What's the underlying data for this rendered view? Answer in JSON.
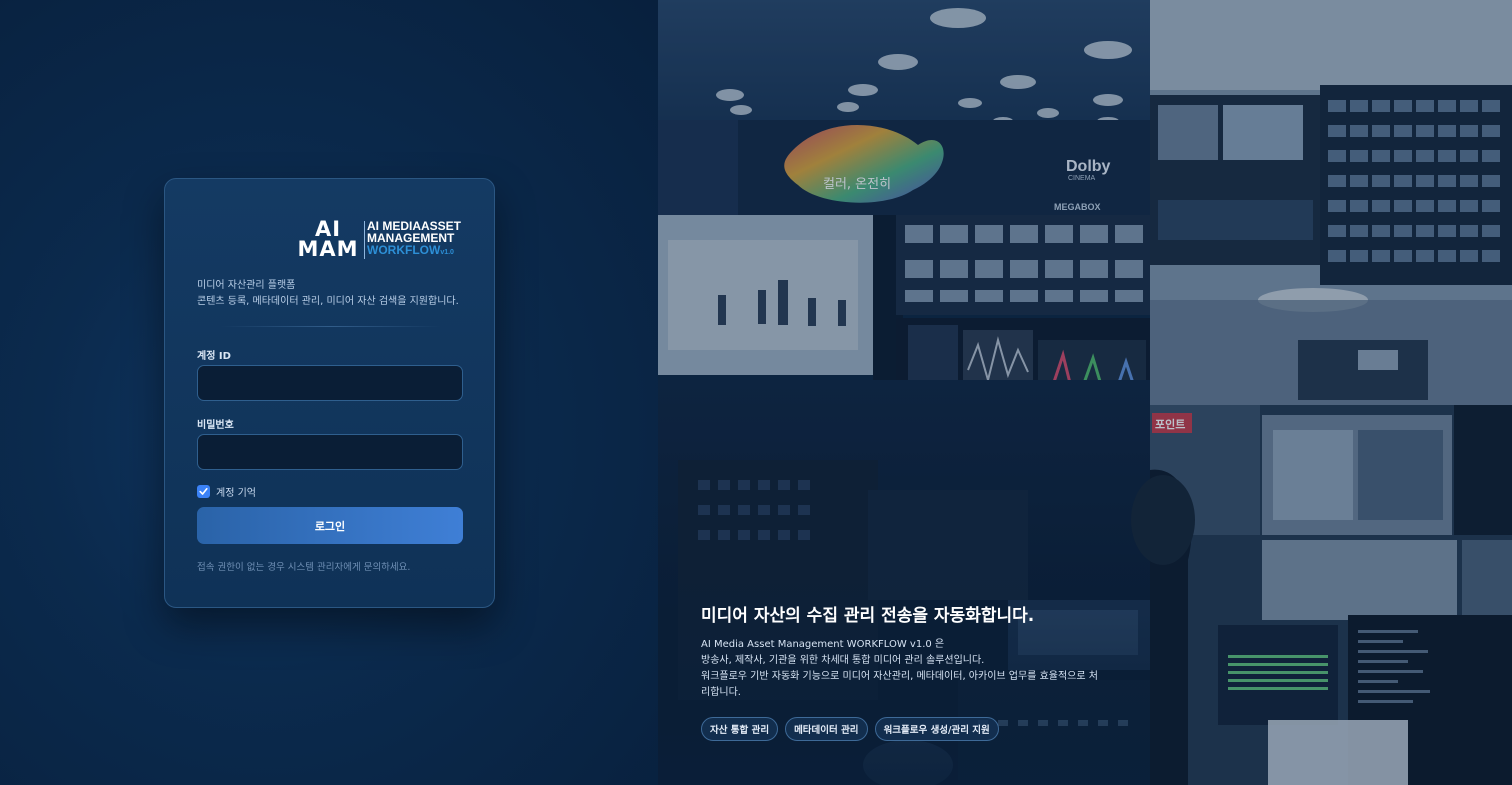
{
  "logo": {
    "mark_line1": "AI",
    "mark_line2": "MAM",
    "text_line1": "AI MEDIAASSET",
    "text_line2": "MANAGEMENT",
    "text_line3": "WORKFLOW",
    "version": "v1.0"
  },
  "intro": {
    "title": "미디어 자산관리 플랫폼",
    "description": "콘텐츠 등록, 메타데이터 관리, 미디어 자산 검색을 지원합니다."
  },
  "form": {
    "id_label": "계정 ID",
    "id_value": "",
    "password_label": "비밀번호",
    "password_value": "",
    "remember_label": "계정 기억",
    "remember_checked": true,
    "login_label": "로그인",
    "help_text": "접속 권한이 없는 경우 시스템 관리자에게 문의하세요."
  },
  "hero": {
    "title": "미디어 자산의 수집 관리 전송을 자동화합니다.",
    "desc_line1": "AI Media Asset Management WORKFLOW v1.0 은",
    "desc_line2": "방송사, 제작사, 기관을 위한 차세대 통합 미디어 관리 솔루션입니다.",
    "desc_line3": "워크플로우 기반 자동화 기능으로 미디어 자산관리, 메타데이터, 아카이브 업무를 효율적으로 처",
    "desc_line4": "리합니다.",
    "chips": [
      "자산 통합 관리",
      "메타데이터 관리",
      "워크플로우 생성/관리 지원"
    ]
  },
  "background_photo": {
    "screen_text_dolby": "Dolby",
    "screen_text_cinema": "CINEMA",
    "screen_text_megabox": "MEGABOX",
    "screen_text_korean": "컬러, 온전히",
    "screen_tag": "포인트"
  },
  "colors": {
    "accent": "#3f7fd6",
    "background": "#0b2342",
    "card": "#143a63",
    "logo_blue": "#2d8fd6"
  }
}
